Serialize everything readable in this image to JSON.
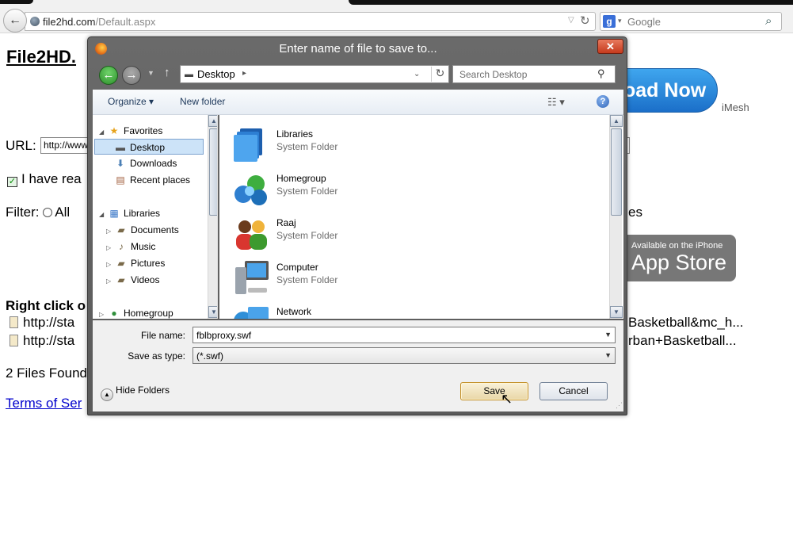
{
  "browser": {
    "url_host": "file2hd.com",
    "url_path": "/Default.aspx",
    "search_placeholder": "Google"
  },
  "page": {
    "site_title": "File2HD.",
    "url_label": "URL:",
    "url_value": "http://www",
    "agree_text": "I have rea",
    "filter_label": "Filter:",
    "filter_all": "All",
    "filter_right": "es",
    "download_button": "oad Now",
    "imesh_label": "iMesh",
    "appstore_small": "Available on the iPhone",
    "appstore_big": "App Store",
    "right_click_text": "Right click o",
    "links": [
      {
        "left": "http://sta",
        "right": "Basketball&mc_h..."
      },
      {
        "left": "http://sta",
        "right": "rban+Basketball..."
      }
    ],
    "files_found": "2 Files Found",
    "terms_link": "Terms of Ser"
  },
  "dialog": {
    "title": "Enter name of file to save to...",
    "close_label": "✕",
    "breadcrumb": "Desktop",
    "search_placeholder": "Search Desktop",
    "toolbar": {
      "organize": "Organize ▾",
      "new_folder": "New folder"
    },
    "nav_pane": {
      "favorites": "Favorites",
      "desktop": "Desktop",
      "downloads": "Downloads",
      "recent": "Recent places",
      "libraries": "Libraries",
      "documents": "Documents",
      "music": "Music",
      "pictures": "Pictures",
      "videos": "Videos",
      "homegroup": "Homegroup"
    },
    "files": [
      {
        "name": "Libraries",
        "type": "System Folder"
      },
      {
        "name": "Homegroup",
        "type": "System Folder"
      },
      {
        "name": "Raaj",
        "type": "System Folder"
      },
      {
        "name": "Computer",
        "type": "System Folder"
      },
      {
        "name": "Network",
        "type": ""
      }
    ],
    "file_name_label": "File name:",
    "file_name_value": "fblbproxy.swf",
    "save_type_label": "Save as type:",
    "save_type_value": "(*.swf)",
    "hide_folders": "Hide Folders",
    "save_button": "Save",
    "cancel_button": "Cancel"
  }
}
